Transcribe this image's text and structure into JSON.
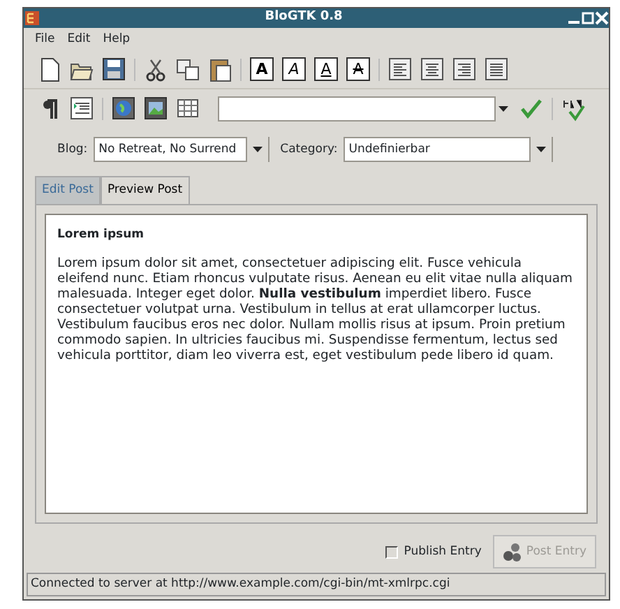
{
  "window": {
    "title": "BloGTK 0.8"
  },
  "menu": [
    "File",
    "Edit",
    "Help"
  ],
  "format_buttons": [
    {
      "kind": "bold",
      "glyph": "A"
    },
    {
      "kind": "italic",
      "glyph": "A"
    },
    {
      "kind": "underline",
      "glyph": "A"
    },
    {
      "kind": "strike",
      "glyph": "A"
    }
  ],
  "blog": {
    "label": "Blog:",
    "value": "No Retreat, No Surrend"
  },
  "category": {
    "label": "Category:",
    "value": "Undefinierbar"
  },
  "tabs": [
    {
      "label": "Edit Post",
      "selected": false
    },
    {
      "label": "Preview Post",
      "selected": true
    }
  ],
  "preview": {
    "heading": "Lorem ipsum",
    "body": "Lorem ipsum dolor sit amet, consectetuer adipiscing elit. Fusce vehicula eleifend nunc. Etiam rhoncus vulputate risus. Aenean eu elit vitae nulla aliquam malesuada. Integer eget dolor. **Nulla vestibulum** imperdiet libero. Fusce consectetuer volutpat urna. Vestibulum in tellus at erat ullamcorper luctus. Vestibulum faucibus eros nec dolor. Nullam mollis risus at ipsum. Proin pretium commodo sapien. In ultricies faucibus mi. Suspendisse fermentum, lectus sed vehicula porttitor, diam leo viverra est, eget vestibulum pede libero id quam."
  },
  "publish": {
    "label": "Publish Entry",
    "checked": false
  },
  "post_button": {
    "label": "Post Entry",
    "disabled": true
  },
  "status_bar": "Connected to server at http://www.example.com/cgi-bin/mt-xmlrpc.cgi"
}
